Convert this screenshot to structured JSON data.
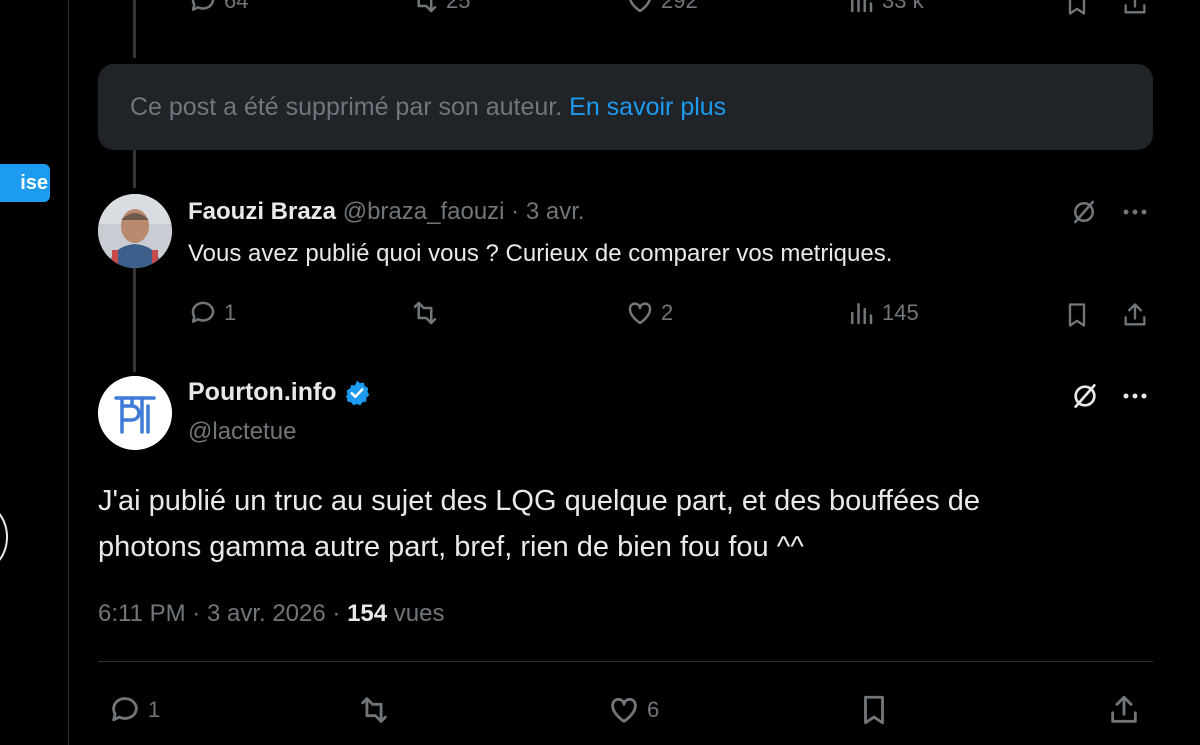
{
  "left": {
    "pill_label": "ise"
  },
  "top_actions": {
    "replies": "64",
    "reposts": "25",
    "likes": "292",
    "views": "33 k"
  },
  "deleted_notice": {
    "text": "Ce post a été supprimé par son auteur.",
    "link": "En savoir plus"
  },
  "reply": {
    "name": "Faouzi Braza",
    "handle": "@braza_faouzi",
    "sep": "·",
    "date": "3 avr.",
    "text": "Vous avez publié quoi vous ? Curieux de comparer vos metriques.",
    "replies": "1",
    "reposts": "",
    "likes": "2",
    "views": "145"
  },
  "main_post": {
    "name": "Pourton.info",
    "handle": "@lactetue",
    "verified": true,
    "text_line1": "J'ai publié un truc au sujet des LQG quelque part, et des bouffées de",
    "text_line2": "photons gamma autre part, bref, rien de bien fou fou ^^",
    "time": "6:11 PM",
    "sep1": "·",
    "date": "3 avr. 2026",
    "sep2": "·",
    "views_count": "154",
    "views_label": "vues",
    "replies": "1",
    "reposts": "",
    "likes": "6"
  },
  "icons": [
    "reply-icon",
    "repost-icon",
    "like-icon",
    "views-icon",
    "bookmark-icon",
    "share-icon",
    "grok-icon",
    "more-icon",
    "verified-badge-icon"
  ],
  "colors": {
    "accent": "#1d9bf0",
    "muted": "#71767b",
    "text": "#e7e9ea",
    "background": "#000000",
    "notice_bg": "#202327"
  }
}
